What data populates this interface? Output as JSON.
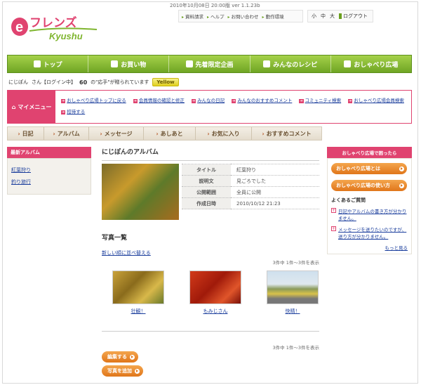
{
  "header": {
    "version": "2010年10月08日 20:00版 ver 1.1.23b",
    "logo_text": "eフレンズ",
    "logo_sub": "Kyushu",
    "util_links": [
      "資料請求",
      "ヘルプ",
      "お問い合わせ",
      "動作環境"
    ],
    "font_sizes": [
      "小",
      "中",
      "大"
    ],
    "logout": "ログアウト"
  },
  "global_nav": [
    {
      "label": "トップ",
      "icon": "home-icon"
    },
    {
      "label": "お買い物",
      "icon": "cart-icon"
    },
    {
      "label": "先着限定企画",
      "icon": "runner-icon"
    },
    {
      "label": "みんなのレシピ",
      "icon": "fork-knife-icon"
    },
    {
      "label": "おしゃべり広場",
      "icon": "chat-bubble-icon"
    }
  ],
  "user": {
    "name": "にじぽん",
    "suffix": "さん【ログイン中】",
    "count": "60",
    "count_text": "の\"応手\"が贈られています",
    "badge": "Yellow"
  },
  "my_menu": {
    "label": "マイメニュー",
    "items": [
      "おしゃべり広場トップに戻る",
      "会員情報の確認と修正",
      "みんなの日記",
      "みんなのおすすめコメント",
      "コミュニティ検索",
      "おしゃべり広場会員検索",
      "招待する"
    ]
  },
  "sub_nav": [
    "日記",
    "アルバム",
    "メッセージ",
    "あしあと",
    "お気に入り",
    "おすすめコメント"
  ],
  "left_sidebar": {
    "title": "最新アルバム",
    "items": [
      "紅葉狩り",
      "釣り旅行"
    ]
  },
  "main": {
    "title": "にじぽんのアルバム",
    "info": [
      {
        "key": "タイトル",
        "value": "紅葉狩り"
      },
      {
        "key": "説明文",
        "value": "見ごろでした"
      },
      {
        "key": "公開範囲",
        "value": "全員に公開"
      },
      {
        "key": "作成日時",
        "value": "2010/10/12 21:23"
      }
    ],
    "photos_heading": "写真一覧",
    "sort_link": "新しい順に並べ替える",
    "count_top": "3件中 1件～3件を表示",
    "count_bottom": "3件中 1件～3件を表示",
    "photos": [
      {
        "caption": "壮観！"
      },
      {
        "caption": "もみじさん"
      },
      {
        "caption": "快晴！"
      }
    ],
    "edit_button": "編集する",
    "add_photo_button": "写真を追加"
  },
  "right_sidebar": {
    "title": "おしゃべり広場で困ったら",
    "buttons": [
      "おしゃべり広場とは",
      "おしゃべり広場の使い方"
    ],
    "faq_title": "よくあるご質問",
    "faq": [
      "日記やアルバムの書き方が分かりません。",
      "メッセージを送りたいのですが、送り方が分かりません。"
    ],
    "more": "もっと見る"
  },
  "colors": {
    "accent_pink": "#e04370",
    "nav_green": "#7fb52f",
    "orange_button": "#e98a2e",
    "link_blue": "#1a3d9c"
  }
}
